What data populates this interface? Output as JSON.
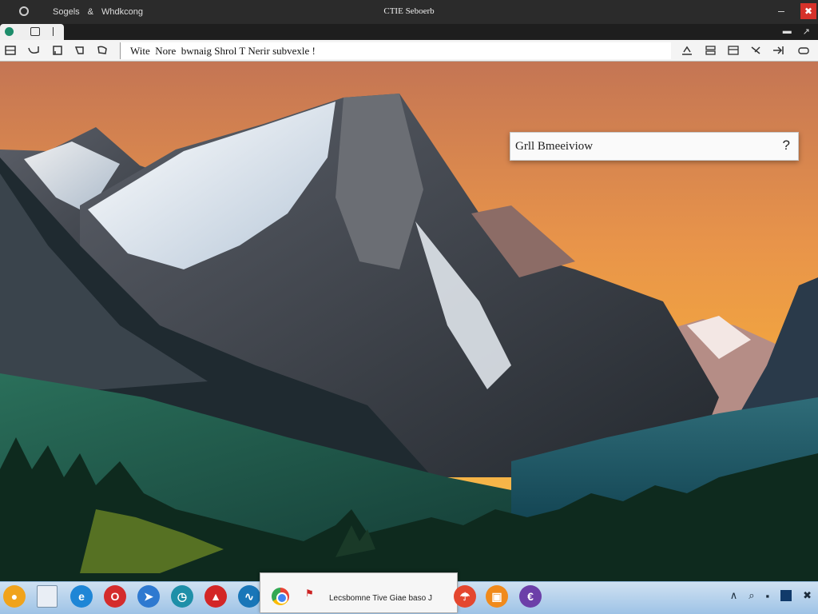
{
  "window": {
    "title": "CTIE Seboerb",
    "menu": [
      "Sogels",
      "&",
      "Whdkcong"
    ],
    "close_glyph": "✖"
  },
  "tabstrip": {
    "right_items": [
      "▬",
      "↗"
    ]
  },
  "toolbar": {
    "address_value": "Wite  Nore  bwnaig Shrol T Nerir subvexle !"
  },
  "search": {
    "value": "Grll Bmeeiviow",
    "help_glyph": "?"
  },
  "taskbar": {
    "window_label": "Lecsbomne  Tive  Giae  baso   J",
    "apps": [
      {
        "name": "app-globe",
        "color": "#f0a31c",
        "glyph": "●"
      },
      {
        "name": "app-notepad",
        "color": "#e9eef5",
        "glyph": ""
      },
      {
        "name": "app-edge",
        "color": "#1e86d6",
        "glyph": "e"
      },
      {
        "name": "app-opera",
        "color": "#d42c2c",
        "glyph": "O"
      },
      {
        "name": "app-bird",
        "color": "#2e79d0",
        "glyph": "➤"
      },
      {
        "name": "app-clock",
        "color": "#1e8fa8",
        "glyph": "◷"
      },
      {
        "name": "app-pdf",
        "color": "#d32626",
        "glyph": "▲"
      },
      {
        "name": "app-wave",
        "color": "#1976b8",
        "glyph": "∿"
      }
    ],
    "apps_right": [
      {
        "name": "app-umbrella",
        "color": "#e4472f",
        "glyph": "☂"
      },
      {
        "name": "app-shop",
        "color": "#f08a1b",
        "glyph": "▣"
      },
      {
        "name": "app-e",
        "color": "#6c3fa8",
        "glyph": "€"
      }
    ],
    "tray": [
      "∧",
      "⌕",
      "▪",
      "✖"
    ]
  },
  "colors": {
    "sky_top": "#c97a50",
    "sky_bottom": "#f2a13a",
    "taskbar": "#b4d2ee"
  }
}
